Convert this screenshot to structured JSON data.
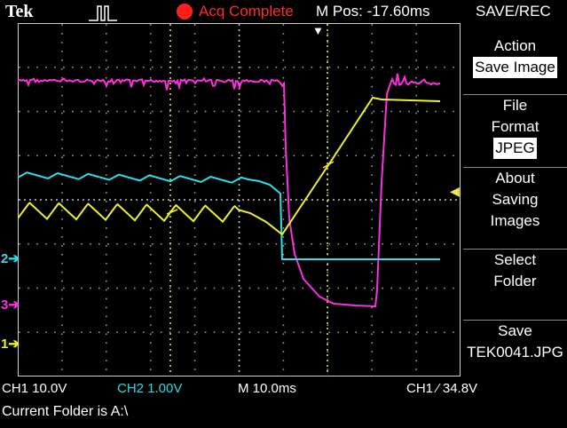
{
  "header": {
    "brand": "Tek",
    "acquisition_status": "Acq Complete",
    "horizontal_position": "M Pos: -17.60ms",
    "menu_title": "SAVE/REC"
  },
  "side_menu": {
    "action_label": "Action",
    "action_value": "Save Image",
    "file_format_label_1": "File",
    "file_format_label_2": "Format",
    "file_format_value": "JPEG",
    "about_1": "About",
    "about_2": "Saving",
    "about_3": "Images",
    "select_1": "Select",
    "select_2": "Folder",
    "save_1": "Save",
    "save_2": "TEK0041.JPG"
  },
  "channel_markers": {
    "ch1": "1",
    "ch2": "2",
    "ch3": "3"
  },
  "status_bar": {
    "ch1_scale": "CH1  10.0V",
    "ch2_scale": "CH2  1.00V",
    "timebase": "M 10.0ms",
    "trigger": "CH1 ⁄ 34.8V",
    "current_folder": "Current Folder is A:\\"
  },
  "colors": {
    "ch1": "#f0f02a",
    "ch2": "#2be0e8",
    "ch3": "#ff2fe0",
    "status_red": "#ff2a2a"
  }
}
